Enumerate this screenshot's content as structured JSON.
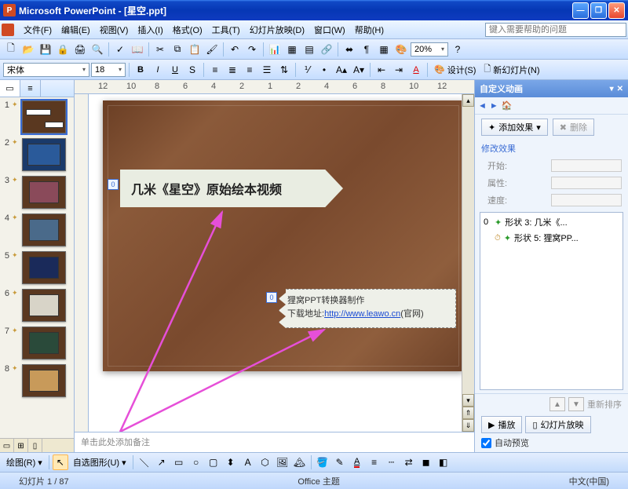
{
  "window": {
    "title": "Microsoft PowerPoint - [星空.ppt]"
  },
  "menu": {
    "items": [
      "文件(F)",
      "编辑(E)",
      "视图(V)",
      "插入(I)",
      "格式(O)",
      "工具(T)",
      "幻灯片放映(D)",
      "窗口(W)",
      "帮助(H)"
    ],
    "help_placeholder": "键入需要帮助的问题"
  },
  "toolbar1": {
    "zoom": "20%"
  },
  "toolbar2": {
    "font": "宋体",
    "size": "18",
    "design_label": "设计(S)",
    "newslide_label": "新幻灯片(N)"
  },
  "thumbs": {
    "count": 8,
    "nums": [
      "1",
      "2",
      "3",
      "4",
      "5",
      "6",
      "7",
      "8"
    ]
  },
  "ruler_ticks": [
    "12",
    "10",
    "8",
    "6",
    "4",
    "2",
    "1",
    "2",
    "4",
    "6",
    "8",
    "10",
    "12"
  ],
  "slide": {
    "shape1_text": "几米《星空》原始绘本视频",
    "shape1_tag": "0",
    "shape2_line1": "狸窝PPT转换器制作",
    "shape2_line2_pre": "下载地址:",
    "shape2_link": "http://www.leawo.cn",
    "shape2_line2_post": "(官网)",
    "shape2_tag": "0"
  },
  "notes": {
    "placeholder": "单击此处添加备注"
  },
  "taskpane": {
    "title": "自定义动画",
    "add_effect": "添加效果",
    "remove": "删除",
    "modify_label": "修改效果",
    "start_label": "开始:",
    "prop_label": "属性:",
    "speed_label": "速度:",
    "items": [
      {
        "n": "0",
        "text": "形状 3: 几米《..."
      },
      {
        "n": "",
        "text": "形状 5: 狸窝PP..."
      }
    ],
    "reorder_label": "重新排序",
    "play": "播放",
    "slideshow": "幻灯片放映",
    "autopreview": "自动预览"
  },
  "drawbar": {
    "draw_label": "绘图(R)",
    "autoshape_label": "自选图形(U)"
  },
  "status": {
    "slide": "幻灯片 1 / 87",
    "theme": "Office 主题",
    "lang": "中文(中国)"
  }
}
